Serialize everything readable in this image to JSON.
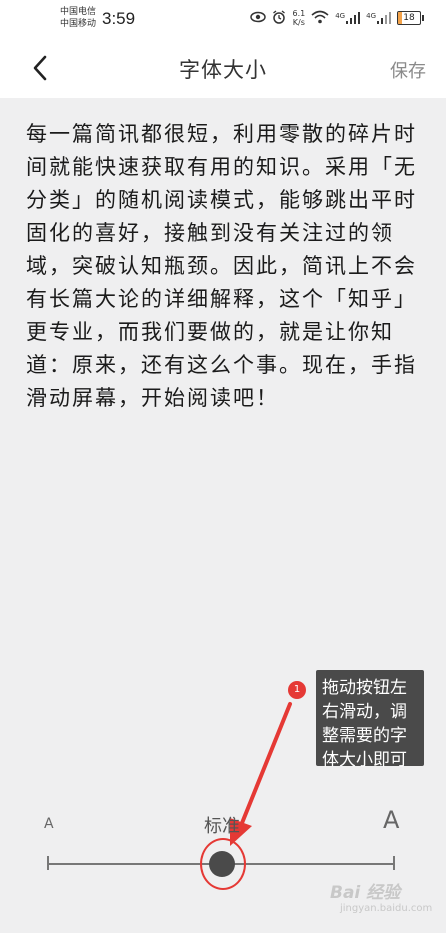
{
  "status_bar": {
    "carrier_1": "中国电信",
    "carrier_2": "中国移动",
    "time": "3:59",
    "net_speed_value": "6.1",
    "net_speed_unit": "K/s",
    "signal_1_label": "4G",
    "signal_2_label": "4G",
    "battery_level": "18",
    "battery_fraction": 0.18,
    "icons": [
      "eye-icon",
      "alarm-icon",
      "wifi-icon",
      "signal-icon",
      "signal-icon",
      "battery-icon"
    ]
  },
  "nav": {
    "back_icon": "back-arrow-icon",
    "title": "字体大小",
    "save_label": "保存"
  },
  "preview": {
    "text": "每一篇简讯都很短，利用零散的碎片时间就能快速获取有用的知识。采用「无分类」的随机阅读模式，能够跳出平时固化的喜好，接触到没有关注过的领域，突破认知瓶颈。因此，简讯上不会有长篇大论的详细解释，这个「知乎」更专业，而我们要做的，就是让你知道：原来，还有这么个事。现在，手指滑动屏幕，开始阅读吧！"
  },
  "annotation": {
    "badge_number": "1",
    "text": "拖动按钮左右滑动，调整需要的字体大小即可",
    "accent_color": "#e53935"
  },
  "font_size_slider": {
    "small_label": "A",
    "large_label": "A",
    "current_label": "标准",
    "tick_count": 3,
    "selected_index": 1
  },
  "watermark": {
    "text": "Bai 经验",
    "sub": "jingyan.baidu.com"
  }
}
